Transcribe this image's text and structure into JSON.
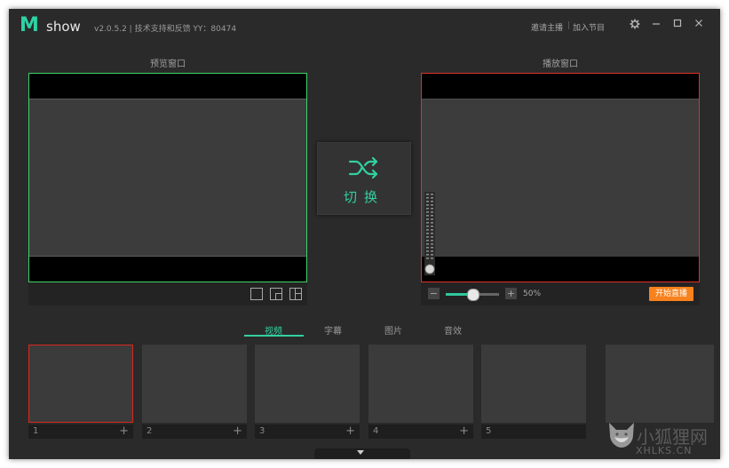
{
  "app": {
    "logo_mark": "M",
    "logo_text": "show",
    "version_info": "v2.0.5.2 | 技术支持和反馈 YY：80474",
    "invite_host": "邀请主播",
    "join_show": "加入节目",
    "divider": "|"
  },
  "panels": {
    "preview_title": "预览窗口",
    "program_title": "播放窗口"
  },
  "switch": {
    "label": "切换",
    "icon": "shuffle-icon",
    "color": "#32d0a0"
  },
  "volume": {
    "minus": "−",
    "plus": "+",
    "percent": "50%",
    "level": 0.5
  },
  "live_button": "开始直播",
  "tabs": [
    "视频",
    "字幕",
    "图片",
    "音效"
  ],
  "active_tab": 0,
  "sources": [
    {
      "num": "1",
      "plus": "+",
      "selected": true
    },
    {
      "num": "2",
      "plus": "+",
      "selected": false
    },
    {
      "num": "3",
      "plus": "+",
      "selected": false
    },
    {
      "num": "4",
      "plus": "+",
      "selected": false
    },
    {
      "num": "5",
      "plus": "",
      "selected": false
    }
  ],
  "watermark": {
    "text": "小狐狸网",
    "sub": "XHLKS.CN"
  },
  "colors": {
    "accent": "#32d0a0",
    "preview_border": "#3fd46a",
    "program_border": "#e0302a",
    "live": "#f7811c"
  }
}
